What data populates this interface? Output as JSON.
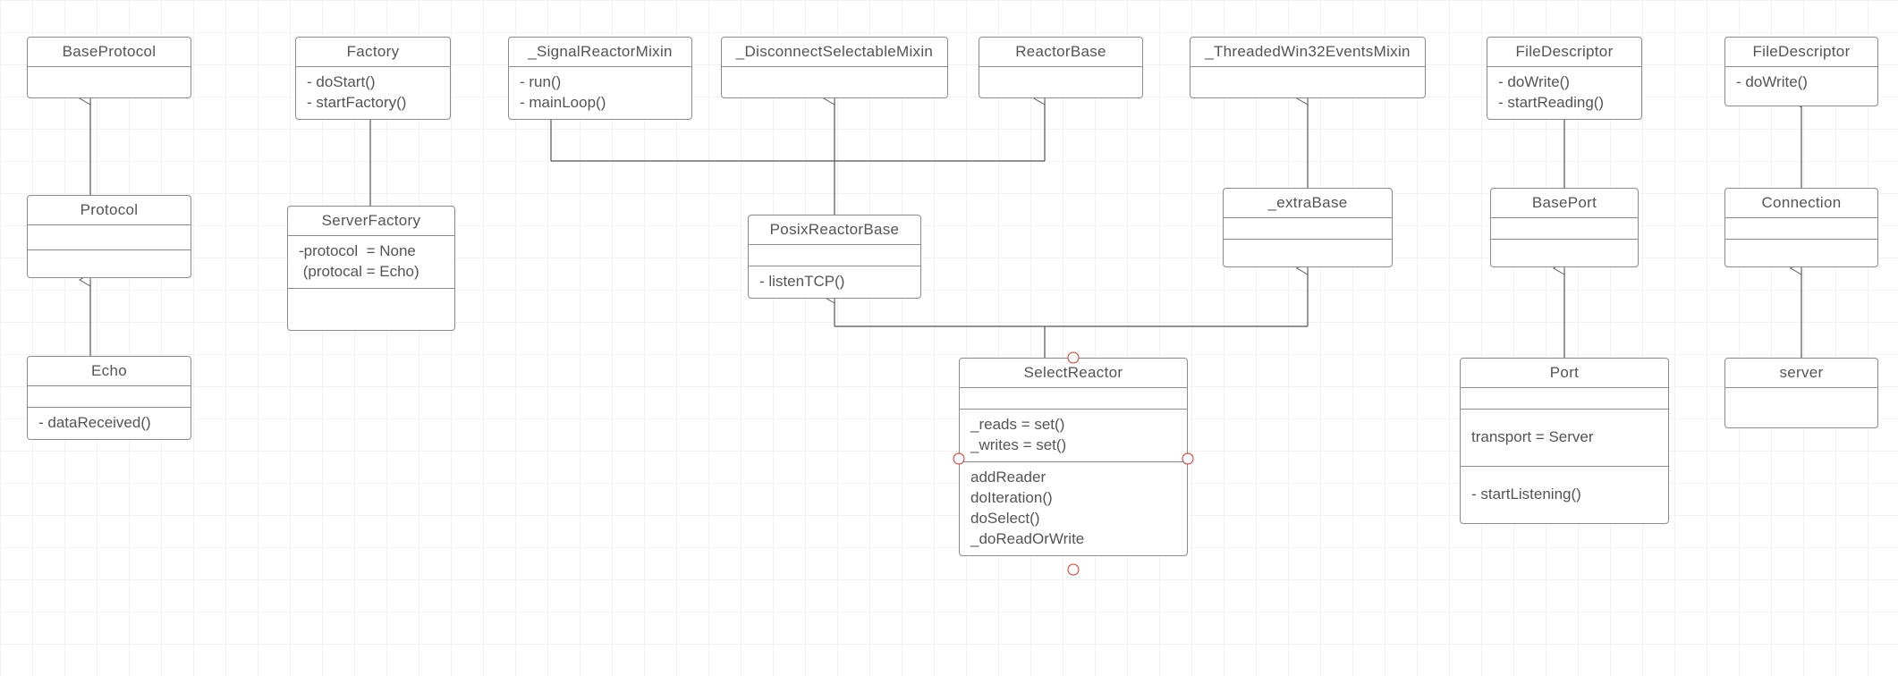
{
  "diagram": {
    "type": "uml-class",
    "boxes": {
      "BaseProtocol": {
        "title": "BaseProtocol",
        "sections": [
          []
        ]
      },
      "Protocol": {
        "title": "Protocol",
        "sections": [
          [],
          []
        ]
      },
      "Echo": {
        "title": "Echo",
        "sections": [
          [],
          [
            "- dataReceived()"
          ]
        ]
      },
      "Factory": {
        "title": "Factory",
        "sections": [
          [
            "- doStart()",
            "- startFactory()"
          ]
        ]
      },
      "ServerFactory": {
        "title": "ServerFactory",
        "sections": [
          [
            "-protocol  = None",
            " (protocal = Echo)"
          ],
          []
        ]
      },
      "SignalReactorMixin": {
        "title": "_SignalReactorMixin",
        "sections": [
          [
            "- run()",
            "- mainLoop()"
          ]
        ]
      },
      "DisconnectMixin": {
        "title": "_DisconnectSelectableMixin",
        "sections": [
          []
        ]
      },
      "ReactorBase": {
        "title": "ReactorBase",
        "sections": [
          []
        ]
      },
      "ThreadedWin32": {
        "title": "_ThreadedWin32EventsMixin",
        "sections": [
          []
        ]
      },
      "PosixReactorBase": {
        "title": "PosixReactorBase",
        "sections": [
          [],
          [
            "- listenTCP()"
          ]
        ]
      },
      "extraBase": {
        "title": "_extraBase",
        "sections": [
          [],
          []
        ]
      },
      "SelectReactor": {
        "title": "SelectReactor",
        "sections": [
          [],
          [
            "_reads = set()",
            "_writes = set()"
          ],
          [
            "addReader",
            "doIteration()",
            "doSelect()",
            "_doReadOrWrite"
          ]
        ]
      },
      "FileDescriptor1": {
        "title": "FileDescriptor",
        "sections": [
          [
            "- doWrite()",
            "- startReading()"
          ]
        ]
      },
      "BasePort": {
        "title": "BasePort",
        "sections": [
          [],
          []
        ]
      },
      "Port": {
        "title": "Port",
        "sections": [
          [],
          [
            "transport = Server"
          ],
          [
            "- startListening()"
          ]
        ]
      },
      "FileDescriptor2": {
        "title": "FileDescriptor",
        "sections": [
          [
            "- doWrite()"
          ]
        ]
      },
      "Connection": {
        "title": "Connection",
        "sections": [
          [],
          []
        ]
      },
      "server": {
        "title": "server",
        "sections": [
          []
        ]
      }
    },
    "edges": [
      {
        "from": "Protocol",
        "to": "BaseProtocol",
        "kind": "inherit"
      },
      {
        "from": "Echo",
        "to": "Protocol",
        "kind": "inherit"
      },
      {
        "from": "ServerFactory",
        "to": "Factory",
        "kind": "inherit"
      },
      {
        "from": "PosixReactorBase",
        "to": "SignalReactorMixin",
        "kind": "inherit"
      },
      {
        "from": "PosixReactorBase",
        "to": "DisconnectMixin",
        "kind": "inherit"
      },
      {
        "from": "PosixReactorBase",
        "to": "ReactorBase",
        "kind": "inherit"
      },
      {
        "from": "extraBase",
        "to": "ThreadedWin32",
        "kind": "inherit"
      },
      {
        "from": "SelectReactor",
        "to": "PosixReactorBase",
        "kind": "inherit"
      },
      {
        "from": "SelectReactor",
        "to": "extraBase",
        "kind": "inherit"
      },
      {
        "from": "BasePort",
        "to": "FileDescriptor1",
        "kind": "inherit"
      },
      {
        "from": "Port",
        "to": "BasePort",
        "kind": "inherit"
      },
      {
        "from": "Connection",
        "to": "FileDescriptor2",
        "kind": "inherit"
      },
      {
        "from": "server",
        "to": "Connection",
        "kind": "inherit"
      }
    ],
    "layout_note": "Boxes are UML class boxes; arrows are hollow-triangle generalization (inheritance) pointing at the parent.",
    "selection": "SelectReactor box is selected (red resize handles shown)."
  }
}
